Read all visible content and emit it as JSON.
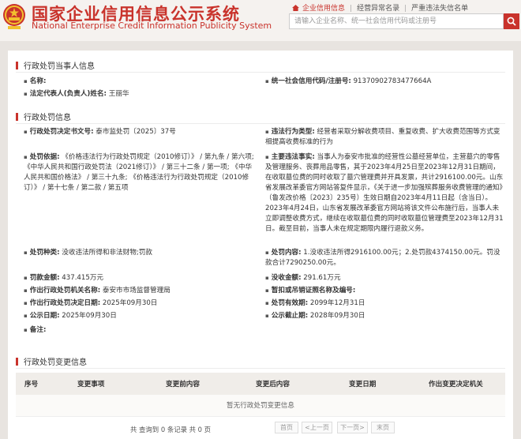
{
  "header": {
    "title_cn": "国家企业信用信息公示系统",
    "title_en": "National Enterprise Credit Information Publicity System",
    "links": [
      "企业信用信息",
      "经营异常名录",
      "严重违法失信名单"
    ],
    "search_placeholder": "请输入企业名称、统一社会信用代码或注册号"
  },
  "party": {
    "title": "行政处罚当事人信息",
    "name_label": "名称:",
    "name_value": "",
    "credit_label": "统一社会信用代码/注册号:",
    "credit_value": "91370902783477664A",
    "rep_label": "法定代表人(负责人)姓名:",
    "rep_value": "王丽华"
  },
  "penalty": {
    "title": "行政处罚信息",
    "doc_label": "行政处罚决定书文号:",
    "doc_value": "泰市监处罚〔2025〕37号",
    "type_label": "违法行为类型:",
    "type_value": "经营者采取分解收费项目、重复收费、扩大收费范围等方式变相提高收费标准的行为",
    "basis_label": "处罚依据:",
    "basis_value": "《价格违法行为行政处罚规定（2010修订）》 / 第九条 / 第六项; 《中华人民共和国行政处罚法（2021修订）》 / 第三十二条 / 第一项; 《中华人民共和国价格法》 / 第三十九条; 《价格违法行为行政处罚规定（2010修订）》 / 第十七条 / 第二款 / 第五项",
    "facts_label": "主要违法事实:",
    "facts_value": "当事人为泰安市批准的经营性公墓经营单位，主营墓穴的零售及管理服务、丧葬用品零售，其于2023年4月25日至2023年12月31日期间，在收取墓位费的同时收取了墓穴管理费并开具发票，共计2916100.00元。山东省发展改革委官方网站答复件显示，《关于进一步加强殡葬服务收费管理的通知》（鲁发改价格〔2023〕235号）生效日期自2023年4月11日起（含当日）。2023年4月24日，山东省发展改革委官方网站将该文件公布施行后，当事人未立即调整收费方式，继续在收取墓位费的同时收取墓位管理费至2023年12月31日。截至目前，当事人未在规定期限内履行退款义务。",
    "kind_label": "处罚种类:",
    "kind_value": "没收违法所得和非法财物;罚款",
    "content_label": "处罚内容:",
    "content_value": "1.没收违法所得2916100.00元；2.处罚款4374150.00元。罚没款合计7290250.00元。",
    "fine_label": "罚款金额:",
    "fine_value": "437.415万元",
    "confiscate_label": "没收金额:",
    "confiscate_value": "291.61万元",
    "org_label": "作出行政处罚机关名称:",
    "org_value": "泰安市市场监督管理局",
    "license_label": "暂扣或吊销证照名称及编号:",
    "license_value": "",
    "date_label": "作出行政处罚决定日期:",
    "date_value": "2025年09月30日",
    "period_label": "处罚有效期:",
    "period_value": "2099年12月31日",
    "pub_label": "公示日期:",
    "pub_value": "2025年09月30日",
    "pubend_label": "公示截止期:",
    "pubend_value": "2028年09月30日",
    "remark_label": "备注:",
    "remark_value": ""
  },
  "changes": {
    "title": "行政处罚变更信息",
    "columns": [
      "序号",
      "变更事项",
      "变更前内容",
      "变更后内容",
      "变更日期",
      "作出变更决定机关"
    ],
    "empty_text": "暂无行政处罚变更信息",
    "pager_info": "共 查询到 0 条记录 共 0 页",
    "pager_buttons": [
      "首页",
      "<上一页",
      "下一页>",
      "末页"
    ]
  },
  "colors": {
    "brand": "#c9332c",
    "background": "#e8e4e0",
    "table_header": "#f0ede9"
  }
}
